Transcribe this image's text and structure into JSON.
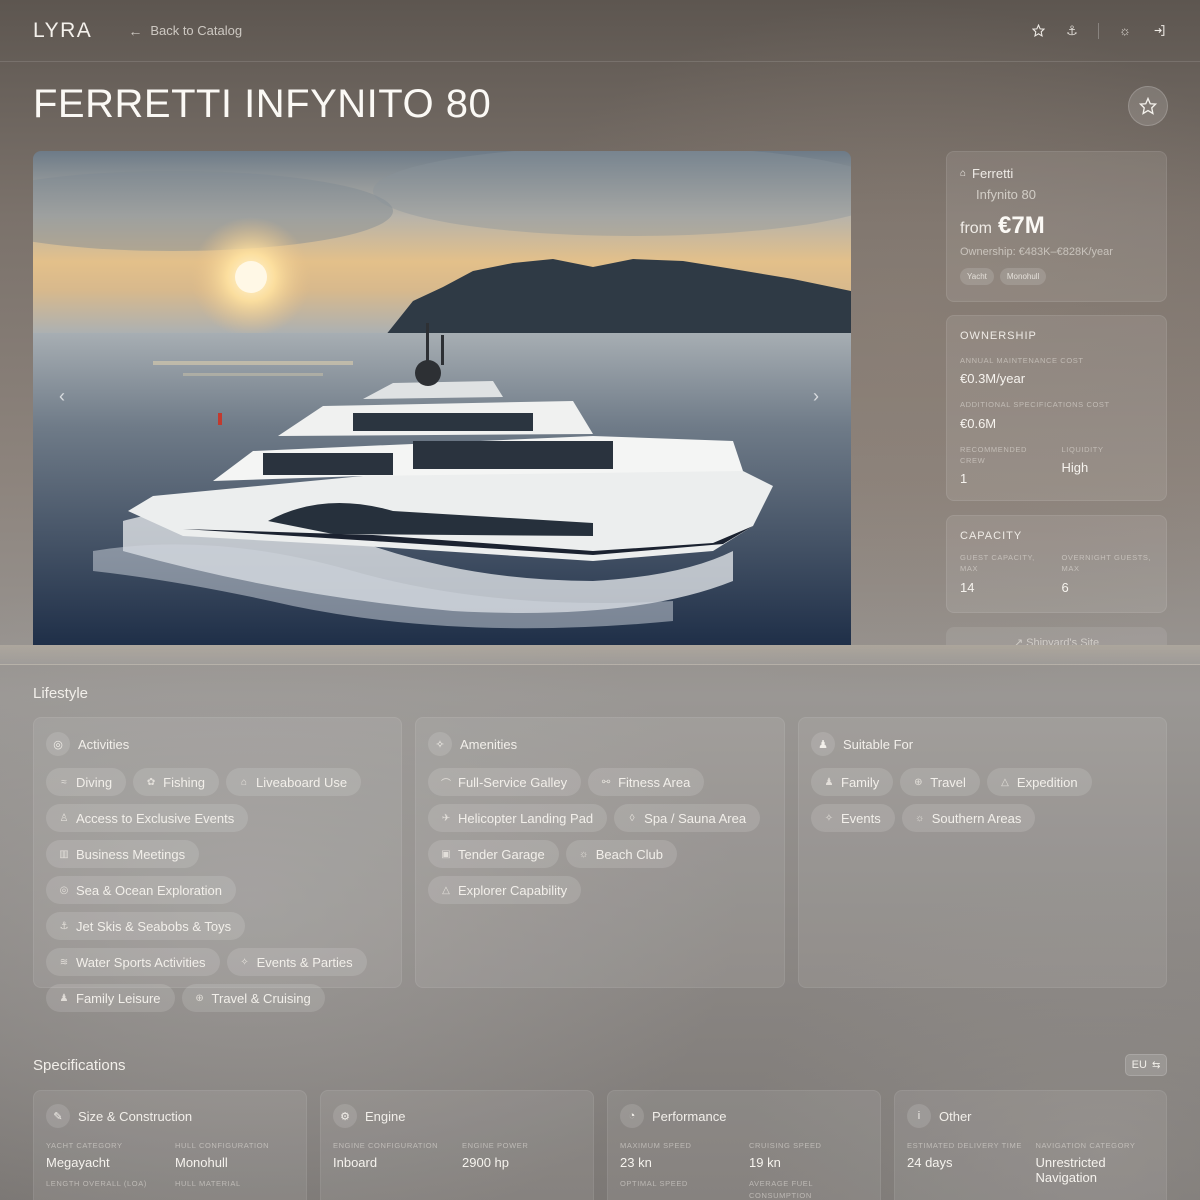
{
  "header": {
    "logo": "LYRA",
    "back_label": "Back to Catalog"
  },
  "title": "FERRETTI INFYNITO 80",
  "summary": {
    "maker": "Ferretti",
    "model": "Infynito 80",
    "price_prefix": "from",
    "price": "€7M",
    "ownership_line": "Ownership: €483K–€828K/year",
    "tags": [
      "Yacht",
      "Monohull"
    ]
  },
  "ownership": {
    "heading": "OWNERSHIP",
    "maint_label": "ANNUAL MAINTENANCE COST",
    "maint_value": "€0.3M/year",
    "addl_label": "ADDITIONAL SPECIFICATIONS COST",
    "addl_value": "€0.6M",
    "crew_label": "RECOMMENDED CREW",
    "crew_value": "1",
    "liq_label": "LIQUIDITY",
    "liq_value": "High"
  },
  "capacity": {
    "heading": "CAPACITY",
    "guest_label": "GUEST CAPACITY, MAX",
    "guest_value": "14",
    "overnight_label": "OVERNIGHT GUESTS, MAX",
    "overnight_value": "6"
  },
  "shipyard_link": "Shipyard's Site",
  "lifestyle": {
    "title": "Lifestyle",
    "activities": {
      "heading": "Activities",
      "items": [
        {
          "label": "Diving",
          "icon": "≈"
        },
        {
          "label": "Fishing",
          "icon": "✿"
        },
        {
          "label": "Liveaboard Use",
          "icon": "⌂"
        },
        {
          "label": "Access to Exclusive Events",
          "icon": "♙"
        },
        {
          "label": "Business Meetings",
          "icon": "▥"
        },
        {
          "label": "Sea & Ocean Exploration",
          "icon": "◎"
        },
        {
          "label": "Jet Skis & Seabobs & Toys",
          "icon": "⚓"
        },
        {
          "label": "Water Sports Activities",
          "icon": "≋"
        },
        {
          "label": "Events & Parties",
          "icon": "✧"
        },
        {
          "label": "Family Leisure",
          "icon": "♟"
        },
        {
          "label": "Travel & Cruising",
          "icon": "⊕"
        }
      ]
    },
    "amenities": {
      "heading": "Amenities",
      "items": [
        {
          "label": "Full-Service Galley",
          "icon": "⌒"
        },
        {
          "label": "Fitness Area",
          "icon": "⚯"
        },
        {
          "label": "Helicopter Landing Pad",
          "icon": "✈"
        },
        {
          "label": "Spa / Sauna Area",
          "icon": "◊"
        },
        {
          "label": "Tender Garage",
          "icon": "▣"
        },
        {
          "label": "Beach Club",
          "icon": "☼"
        },
        {
          "label": "Explorer Capability",
          "icon": "△"
        }
      ]
    },
    "suitable": {
      "heading": "Suitable For",
      "items": [
        {
          "label": "Family",
          "icon": "♟"
        },
        {
          "label": "Travel",
          "icon": "⊕"
        },
        {
          "label": "Expedition",
          "icon": "△"
        },
        {
          "label": "Events",
          "icon": "✧"
        },
        {
          "label": "Southern Areas",
          "icon": "☼"
        }
      ]
    }
  },
  "specs": {
    "title": "Specifications",
    "unit_toggle": "EU",
    "size": {
      "heading": "Size & Construction",
      "cat_label": "YACHT CATEGORY",
      "cat_value": "Megayacht",
      "hull_label": "HULL CONFIGURATION",
      "hull_value": "Monohull",
      "loa_label": "LENGTH OVERALL (LOA)",
      "mat_label": "HULL MATERIAL"
    },
    "engine": {
      "heading": "Engine",
      "conf_label": "ENGINE CONFIGURATION",
      "conf_value": "Inboard",
      "power_label": "ENGINE POWER",
      "power_value": "2900 hp"
    },
    "performance": {
      "heading": "Performance",
      "max_label": "MAXIMUM SPEED",
      "max_value": "23 kn",
      "cruise_label": "CRUISING SPEED",
      "cruise_value": "19 kn",
      "opt_label": "OPTIMAL SPEED",
      "fuel_label": "AVERAGE FUEL CONSUMPTION"
    },
    "other": {
      "heading": "Other",
      "del_label": "ESTIMATED DELIVERY TIME",
      "del_value": "24 days",
      "nav_label": "NAVIGATION CATEGORY",
      "nav_value": "Unrestricted Navigation"
    }
  }
}
